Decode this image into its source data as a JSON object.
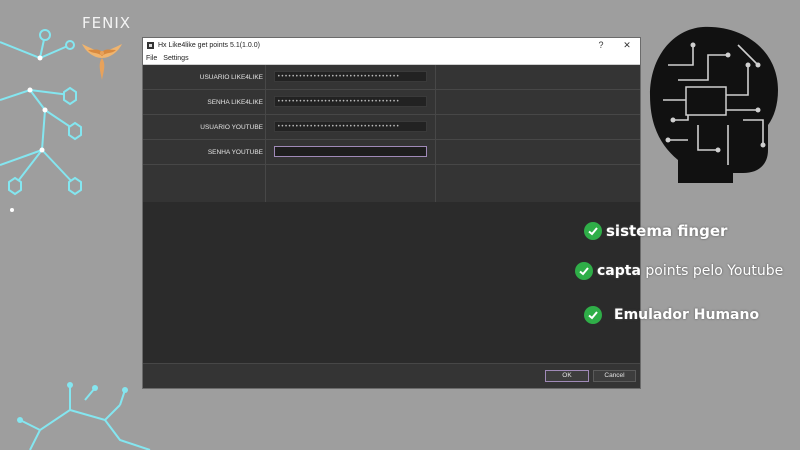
{
  "brand": "FENIX",
  "window": {
    "title": "Hx Like4like get points 5.1(1.0.0)",
    "help_glyph": "?",
    "close_glyph": "✕"
  },
  "menu": {
    "file": "File",
    "settings": "Settings"
  },
  "form": {
    "fields": [
      {
        "label": "USUARIO LIKE4LIKE",
        "value": "••••••••••••••••••••••••••••••••••"
      },
      {
        "label": "SENHA LIKE4LIKE",
        "value": "••••••••••••••••••••••••••••••••••"
      },
      {
        "label": "USUARIO YOUTUBE",
        "value": "••••••••••••••••••••••••••••••••••"
      },
      {
        "label": "SENHA YOUTUBE",
        "value": ""
      }
    ]
  },
  "buttons": {
    "ok": "OK",
    "cancel": "Cancel"
  },
  "features": {
    "f1": "sistema finger",
    "f2_bold": "capta",
    "f2_rest": " points pelo Youtube",
    "f3": "Emulador Humano"
  },
  "colors": {
    "background": "#9e9e9e",
    "window_bg": "#2b2b2b",
    "accent_border": "#a08ab8",
    "check_green": "#2fae48",
    "circuit_cyan": "#7fe3ee"
  },
  "icons": {
    "app": "app-icon",
    "check": "check-icon",
    "phoenix": "phoenix-logo",
    "head": "circuit-head-icon"
  }
}
